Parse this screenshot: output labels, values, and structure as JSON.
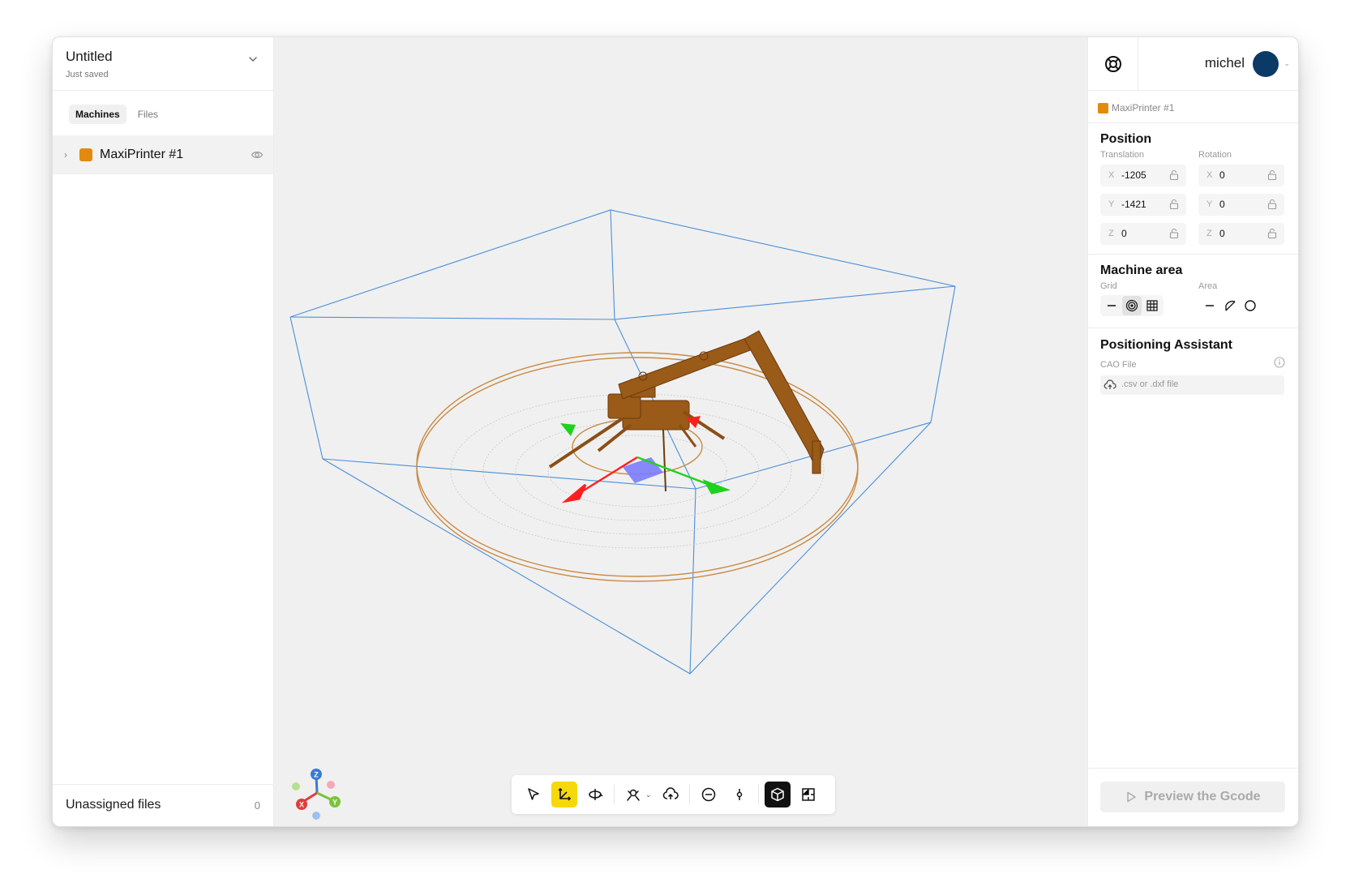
{
  "project": {
    "title": "Untitled",
    "status": "Just saved"
  },
  "left_tabs": [
    {
      "label": "Machines",
      "active": true
    },
    {
      "label": "Files",
      "active": false
    }
  ],
  "machines": [
    {
      "label": "MaxiPrinter #1",
      "color": "#e38a0c"
    }
  ],
  "unassigned": {
    "label": "Unassigned files",
    "count": "0"
  },
  "user": {
    "name": "michel",
    "avatar_color": "#0b3a66"
  },
  "selection": {
    "label": "MaxiPrinter #1"
  },
  "position": {
    "title": "Position",
    "translation_label": "Translation",
    "rotation_label": "Rotation",
    "translation": [
      {
        "axis": "X",
        "value": "-1205"
      },
      {
        "axis": "Y",
        "value": "-1421"
      },
      {
        "axis": "Z",
        "value": "0"
      }
    ],
    "rotation": [
      {
        "axis": "X",
        "value": "0"
      },
      {
        "axis": "Y",
        "value": "0"
      },
      {
        "axis": "Z",
        "value": "0"
      }
    ]
  },
  "machine_area": {
    "title": "Machine area",
    "grid_label": "Grid",
    "area_label": "Area",
    "grid_options": [
      "none-icon",
      "radial-grid-icon",
      "square-grid-icon"
    ],
    "grid_selected": "radial-grid-icon",
    "area_options": [
      "none-icon",
      "sector-icon",
      "circle-icon"
    ]
  },
  "assistant": {
    "title": "Positioning Assistant",
    "file_label": "CAO File",
    "file_placeholder": ".csv or .dxf file"
  },
  "preview": {
    "label": "Preview the Gcode"
  },
  "gizmo": {
    "x": "X",
    "y": "Y",
    "z": "Z"
  },
  "toolbar": {
    "tools": [
      "select-icon",
      "translate-icon",
      "rotate-icon",
      "auto-position-icon",
      "upload-icon",
      "zoom-out-icon",
      "pivot-icon",
      "3d-view-icon",
      "top-view-icon"
    ],
    "active_tool": "translate-icon"
  },
  "colors": {
    "accent": "#f5d90a",
    "machine": "#e38a0c",
    "bounds": "#4a8fd8",
    "x_axis": "#ff1f1f",
    "y_axis": "#1fd11f",
    "plane": "#7b7bff"
  }
}
